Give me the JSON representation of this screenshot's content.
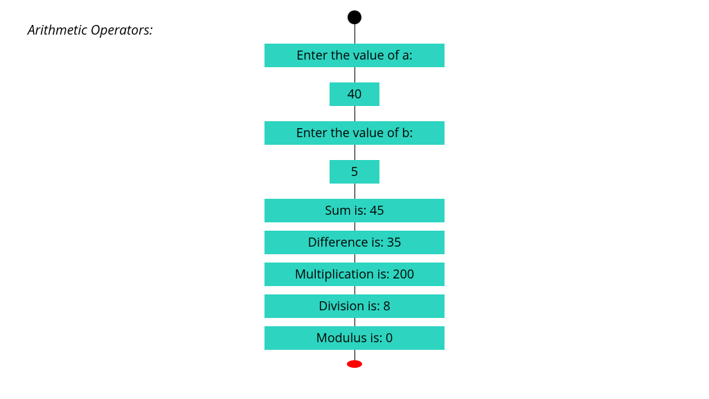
{
  "title": "Arithmetic Operators:",
  "steps": {
    "prompt_a": "Enter the value of a:",
    "value_a": "40",
    "prompt_b": "Enter the value of b:",
    "value_b": "5",
    "sum": "Sum is: 45",
    "difference": "Difference is: 35",
    "multiplication": "Multiplication is: 200",
    "division": "Division is: 8",
    "modulus": "Modulus is: 0"
  },
  "colors": {
    "box": "#2dd4bf",
    "end": "#ff0000"
  }
}
